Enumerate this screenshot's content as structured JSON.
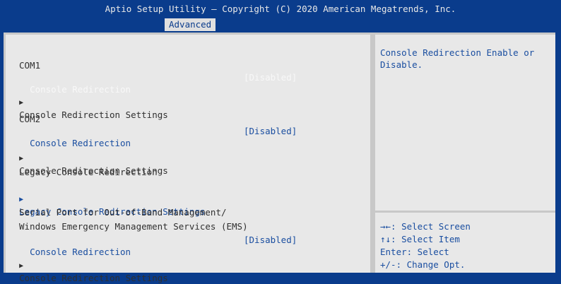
{
  "header": {
    "title": "Aptio Setup Utility – Copyright (C) 2020 American Megatrends, Inc.",
    "tab": "Advanced"
  },
  "main": {
    "com1": {
      "heading": "COM1",
      "redirection_label": "Console Redirection",
      "redirection_value": "[Disabled]",
      "settings_label": "Console Redirection Settings"
    },
    "com2": {
      "heading": "COM2",
      "redirection_label": "Console Redirection",
      "redirection_value": "[Disabled]",
      "settings_label": "Console Redirection Settings"
    },
    "legacy": {
      "heading": "Legacy Console Redirection",
      "settings_label": "Legacy Console Redirection Settings"
    },
    "ems": {
      "heading_line1": "Serial Port for Out-of-Band Management/",
      "heading_line2": "Windows Emergency Management Services (EMS)",
      "redirection_label": "Console Redirection",
      "redirection_value": "[Disabled]",
      "settings_label": "Console Redirection Settings"
    },
    "submenu_arrow_icon": "▶"
  },
  "help": {
    "text": "Console Redirection Enable or Disable."
  },
  "keys": [
    "→←: Select Screen",
    "↑↓: Select Item",
    "Enter: Select",
    "+/-: Change Opt."
  ],
  "colors": {
    "background": "#0a3c8c",
    "panel": "#e8e8e8",
    "selectable": "#1a4ea0",
    "text": "#303030"
  }
}
